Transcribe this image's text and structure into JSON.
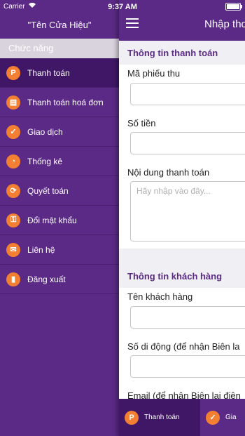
{
  "status": {
    "carrier": "Carrier",
    "time": "9:37 AM"
  },
  "drawer": {
    "store_name": "\"Tên Cửa Hiệu\"",
    "section": "Chức năng",
    "items": [
      {
        "label": "Thanh toán",
        "icon": "P",
        "active": true
      },
      {
        "label": "Thanh toán hoá đơn",
        "icon": "▤"
      },
      {
        "label": "Giao dịch",
        "icon": "✓"
      },
      {
        "label": "Thống kê",
        "icon": "◔"
      },
      {
        "label": "Quyết toán",
        "icon": "⟳"
      },
      {
        "label": "Đổi mật khẩu",
        "icon": "⚿"
      },
      {
        "label": "Liên hệ",
        "icon": "✉"
      },
      {
        "label": "Đăng xuất",
        "icon": "▮"
      }
    ]
  },
  "main": {
    "title": "Nhập tho",
    "payment_group": {
      "title": "Thông tin thanh toán",
      "receipt_label": "Mã phiếu thu",
      "amount_label": "Số tiền",
      "content_label": "Nội dung thanh toán",
      "content_placeholder": "Hãy nhập vào đây..."
    },
    "customer_group": {
      "title": "Thông tin khách hàng",
      "name_label": "Tên khách hàng",
      "phone_label": "Số di động (để nhận Biên la",
      "email_label": "Email (để nhận Biên lai điện"
    }
  },
  "tabbar": {
    "tab1": "Thanh toán",
    "tab2": "Gia"
  },
  "colors": {
    "primary": "#5b2a86",
    "accent": "#f37f32"
  }
}
